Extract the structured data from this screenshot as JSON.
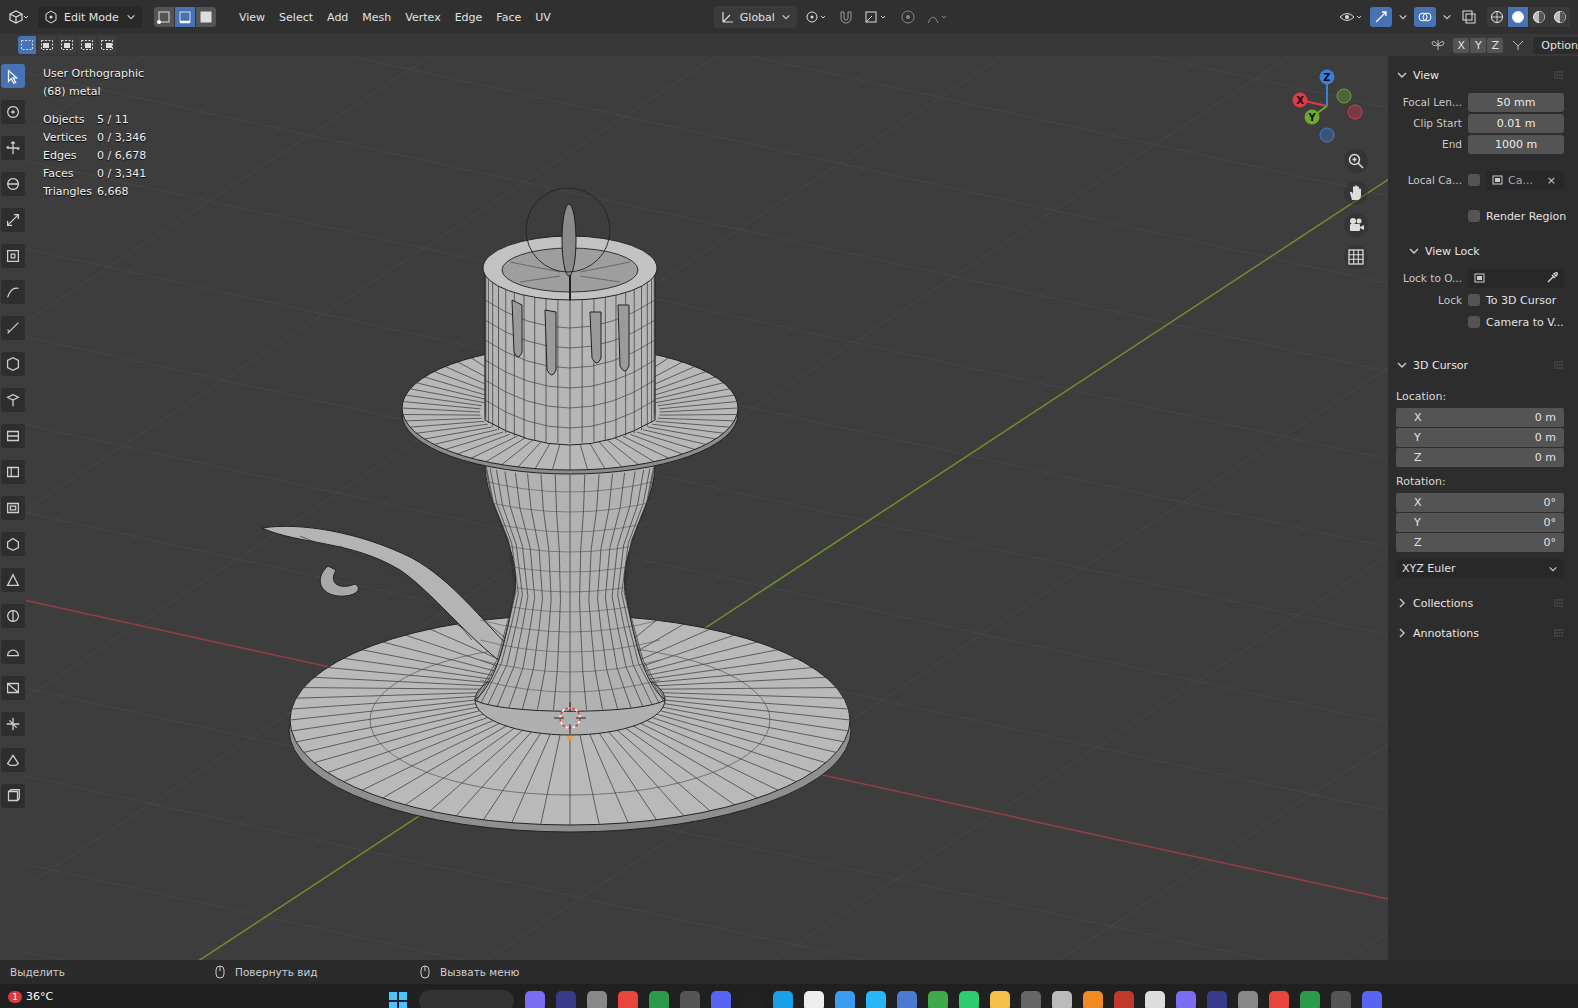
{
  "header": {
    "editor_mode": "Edit Mode",
    "select_modes": [
      {
        "selected": false
      },
      {
        "selected": true
      },
      {
        "selected": false
      }
    ],
    "menus": [
      "View",
      "Select",
      "Add",
      "Mesh",
      "Vertex",
      "Edge",
      "Face",
      "UV"
    ],
    "orientation": "Global",
    "shading_modes": [
      {
        "selected": false
      },
      {
        "selected": true
      },
      {
        "selected": false
      },
      {
        "selected": false
      }
    ]
  },
  "tool_header": {
    "box_modes": [
      {
        "selected": true
      },
      {
        "selected": false
      },
      {
        "selected": false
      },
      {
        "selected": false
      },
      {
        "selected": false
      }
    ],
    "mirror_axes": [
      {
        "label": "X",
        "selected": false
      },
      {
        "label": "Y",
        "selected": false
      },
      {
        "label": "Z",
        "selected": false
      }
    ],
    "options_label": "Option"
  },
  "toolbar": [
    {
      "selected": true
    },
    {
      "selected": false
    },
    {
      "selected": false
    },
    {
      "selected": false
    },
    {
      "selected": false
    },
    {
      "selected": false
    },
    {
      "selected": false
    },
    {
      "selected": false
    },
    {
      "selected": false
    },
    {
      "selected": false
    },
    {
      "selected": false
    },
    {
      "selected": false
    },
    {
      "selected": false
    },
    {
      "selected": false
    },
    {
      "selected": false
    },
    {
      "selected": false
    },
    {
      "selected": false
    },
    {
      "selected": false
    },
    {
      "selected": false
    },
    {
      "selected": false
    },
    {
      "selected": false
    }
  ],
  "viewport": {
    "view_name": "User Orthographic",
    "object_label": "(68) metal",
    "stats": [
      {
        "label": "Objects",
        "value": "5 / 11"
      },
      {
        "label": "Vertices",
        "value": "0 / 3,346"
      },
      {
        "label": "Edges",
        "value": "0 / 6,678"
      },
      {
        "label": "Faces",
        "value": "0 / 3,341"
      },
      {
        "label": "Triangles",
        "value": "6,668"
      }
    ],
    "gizmo_axes": [
      {
        "label": "Z",
        "color": "#3b7fd9"
      },
      {
        "label": "X",
        "color": "#e0394d"
      },
      {
        "label": "Y",
        "color": "#6ea92e"
      }
    ]
  },
  "sidebar": {
    "view": {
      "title": "View",
      "expanded": true,
      "fields": [
        {
          "label": "Focal Len...",
          "value": "50 mm"
        },
        {
          "label": "Clip Start",
          "value": "0.01 m"
        },
        {
          "label": "End",
          "value": "1000 m"
        }
      ],
      "local_camera": {
        "label": "Local Ca...",
        "checked": false,
        "value": "Ca...",
        "clear": "×"
      },
      "render_region": {
        "label": "Render Region",
        "checked": false
      }
    },
    "view_lock": {
      "title": "View Lock",
      "expanded": true,
      "lock_object_label": "Lock to O...",
      "lock_label": "Lock",
      "checks": [
        {
          "label": "To 3D Cursor",
          "checked": false
        },
        {
          "label": "Camera to V...",
          "checked": false
        }
      ]
    },
    "cursor": {
      "title": "3D Cursor",
      "expanded": true,
      "location_label": "Location:",
      "location": [
        {
          "axis": "X",
          "value": "0 m"
        },
        {
          "axis": "Y",
          "value": "0 m"
        },
        {
          "axis": "Z",
          "value": "0 m"
        }
      ],
      "rotation_label": "Rotation:",
      "rotation": [
        {
          "axis": "X",
          "value": "0°"
        },
        {
          "axis": "Y",
          "value": "0°"
        },
        {
          "axis": "Z",
          "value": "0°"
        }
      ],
      "rotation_mode": "XYZ Euler"
    },
    "collapsed": [
      {
        "title": "Collections",
        "expanded": false
      },
      {
        "title": "Annotations",
        "expanded": false
      }
    ]
  },
  "status_bar": [
    {
      "label": "Выделить",
      "icon": false
    },
    {
      "label": "Повернуть вид",
      "icon": true
    },
    {
      "label": "Вызвать меню",
      "icon": true
    }
  ],
  "taskbar": {
    "weather": "36°C",
    "badge": "1"
  }
}
